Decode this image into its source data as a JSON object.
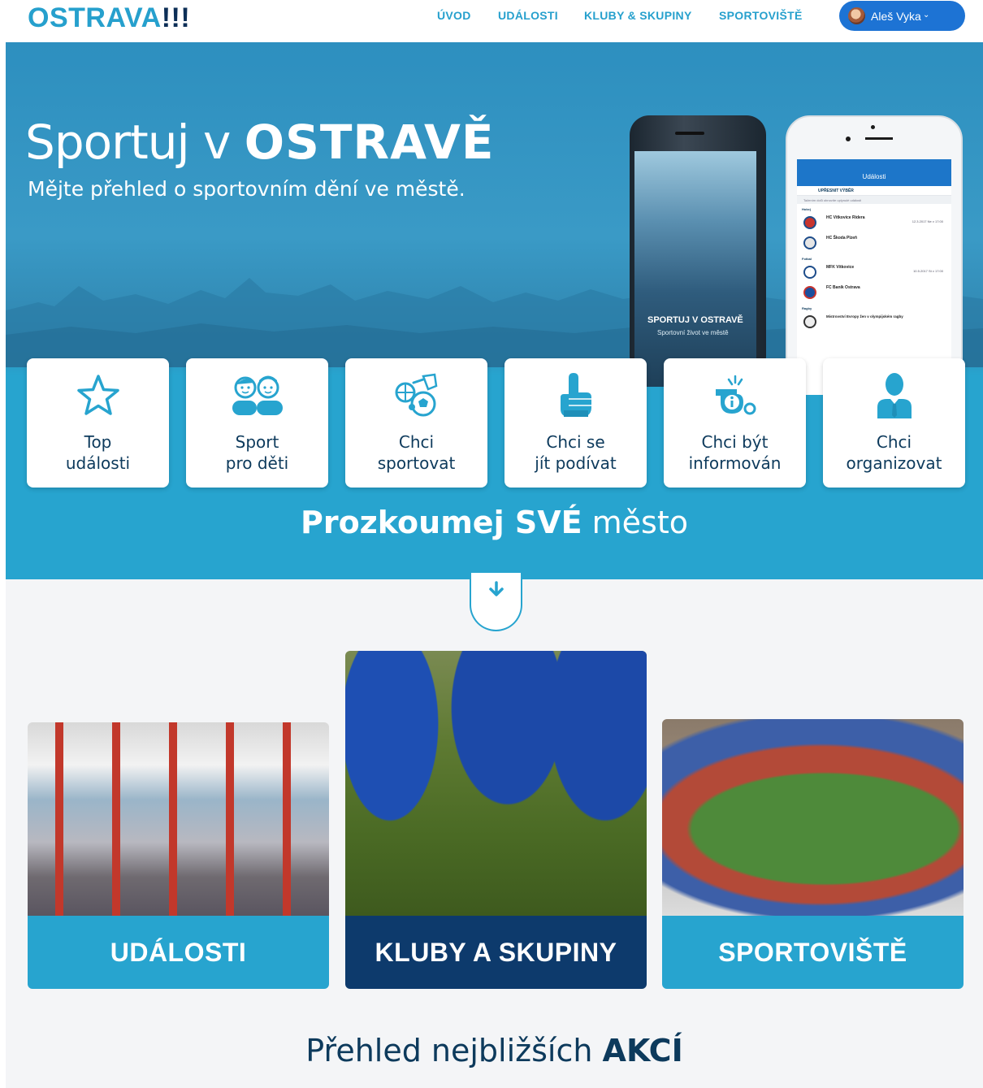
{
  "header": {
    "logo_text": "OSTRAVA",
    "logo_bang": "!!!",
    "nav": [
      "ÚVOD",
      "UDÁLOSTI",
      "KLUBY & SKUPINY",
      "SPORTOVIŠTĚ"
    ],
    "user_name": "Aleš Vyka",
    "user_caret": "⌄"
  },
  "hero": {
    "title_light": "Sportuj v ",
    "title_bold": "OSTRAVĚ",
    "subtitle": "Mějte přehled o sportovním dění ve městě.",
    "phone_left": {
      "title": "SPORTUJ V OSTRAVĚ",
      "subtitle": "Sportovní život ve městě"
    },
    "phone_right": {
      "screen_title": "Události",
      "filter": "UPŘESNIT VÝBĚR",
      "hint": "Tažením dolů obnovíte uplynulé události",
      "categories": [
        {
          "name": "Hokej",
          "rows": [
            {
              "team": "HC Vítkovice Ridera",
              "datetime": "12.3.2017 Ne v 17:00"
            },
            {
              "team": "HC Škoda Plzeň",
              "datetime": ""
            }
          ]
        },
        {
          "name": "Fotbal",
          "rows": [
            {
              "team": "MFK Vítkovice",
              "datetime": "10.5.2017 St v 17:00"
            },
            {
              "team": "FC Baník Ostrava",
              "datetime": ""
            }
          ]
        }
      ],
      "rugby_category": "Ragby",
      "rugby_event": "Mistrovství Evropy žen v olympijském ragby"
    },
    "cards": [
      {
        "line1": "Top",
        "line2": "události",
        "icon": "star-icon"
      },
      {
        "line1": "Sport",
        "line2": "pro děti",
        "icon": "kids-icon"
      },
      {
        "line1": "Chci",
        "line2": "sportovat",
        "icon": "sport-balls-icon"
      },
      {
        "line1": "Chci se",
        "line2": "jít podívat",
        "icon": "foam-finger-icon"
      },
      {
        "line1": "Chci být",
        "line2": "informován",
        "icon": "whistle-info-icon"
      },
      {
        "line1": "Chci",
        "line2": "organizovat",
        "icon": "organizer-icon"
      }
    ],
    "explore_bold": "Prozkoumej SVÉ",
    "explore_light": " město"
  },
  "scroll_button": {
    "icon": "arrow-down-icon",
    "glyph": "🡫"
  },
  "tiles": [
    {
      "label": "UDÁLOSTI"
    },
    {
      "label": "KLUBY A SKUPINY"
    },
    {
      "label": "SPORTOVIŠTĚ"
    }
  ],
  "overview": {
    "light": "Přehled nejbližších ",
    "bold": "AKCÍ"
  },
  "colors": {
    "accent": "#27a4cf",
    "navy": "#0d3a6c",
    "user_button": "#1d73d4",
    "text": "#0d3a5c"
  }
}
